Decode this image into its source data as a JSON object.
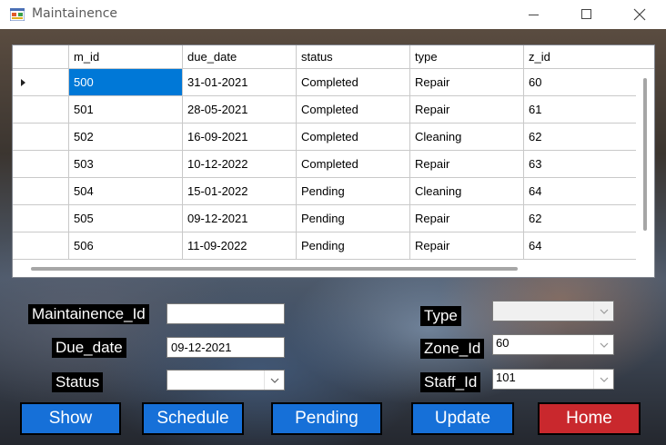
{
  "window": {
    "title": "Maintainence",
    "min_icon": "minimize-icon",
    "max_icon": "maximize-icon",
    "close_icon": "close-icon"
  },
  "grid": {
    "columns": [
      "m_id",
      "due_date",
      "status",
      "type",
      "z_id"
    ],
    "selected_row": 0,
    "rows": [
      {
        "m_id": "500",
        "due_date": "31-01-2021",
        "status": "Completed",
        "type": "Repair",
        "z_id": "60"
      },
      {
        "m_id": "501",
        "due_date": "28-05-2021",
        "status": "Completed",
        "type": "Repair",
        "z_id": "61"
      },
      {
        "m_id": "502",
        "due_date": "16-09-2021",
        "status": "Completed",
        "type": "Cleaning",
        "z_id": "62"
      },
      {
        "m_id": "503",
        "due_date": "10-12-2022",
        "status": "Completed",
        "type": "Repair",
        "z_id": "63"
      },
      {
        "m_id": "504",
        "due_date": "15-01-2022",
        "status": "Pending",
        "type": "Cleaning",
        "z_id": "64"
      },
      {
        "m_id": "505",
        "due_date": "09-12-2021",
        "status": "Pending",
        "type": "Repair",
        "z_id": "62"
      },
      {
        "m_id": "506",
        "due_date": "11-09-2022",
        "status": "Pending",
        "type": "Repair",
        "z_id": "64"
      }
    ]
  },
  "form": {
    "maintainence_id": {
      "label": "Maintainence_Id",
      "value": ""
    },
    "due_date": {
      "label": "Due_date",
      "value": "09-12-2021"
    },
    "status": {
      "label": "Status",
      "value": ""
    },
    "type": {
      "label": "Type",
      "value": ""
    },
    "zone_id": {
      "label": "Zone_Id",
      "value": "60"
    },
    "staff_id": {
      "label": "Staff_Id",
      "value": "101"
    }
  },
  "buttons": {
    "show": "Show",
    "schedule": "Schedule",
    "pending": "Pending",
    "update": "Update",
    "home": "Home"
  },
  "colors": {
    "selection": "#0078d7",
    "button_blue": "#1670d8",
    "button_red": "#c9282d"
  }
}
